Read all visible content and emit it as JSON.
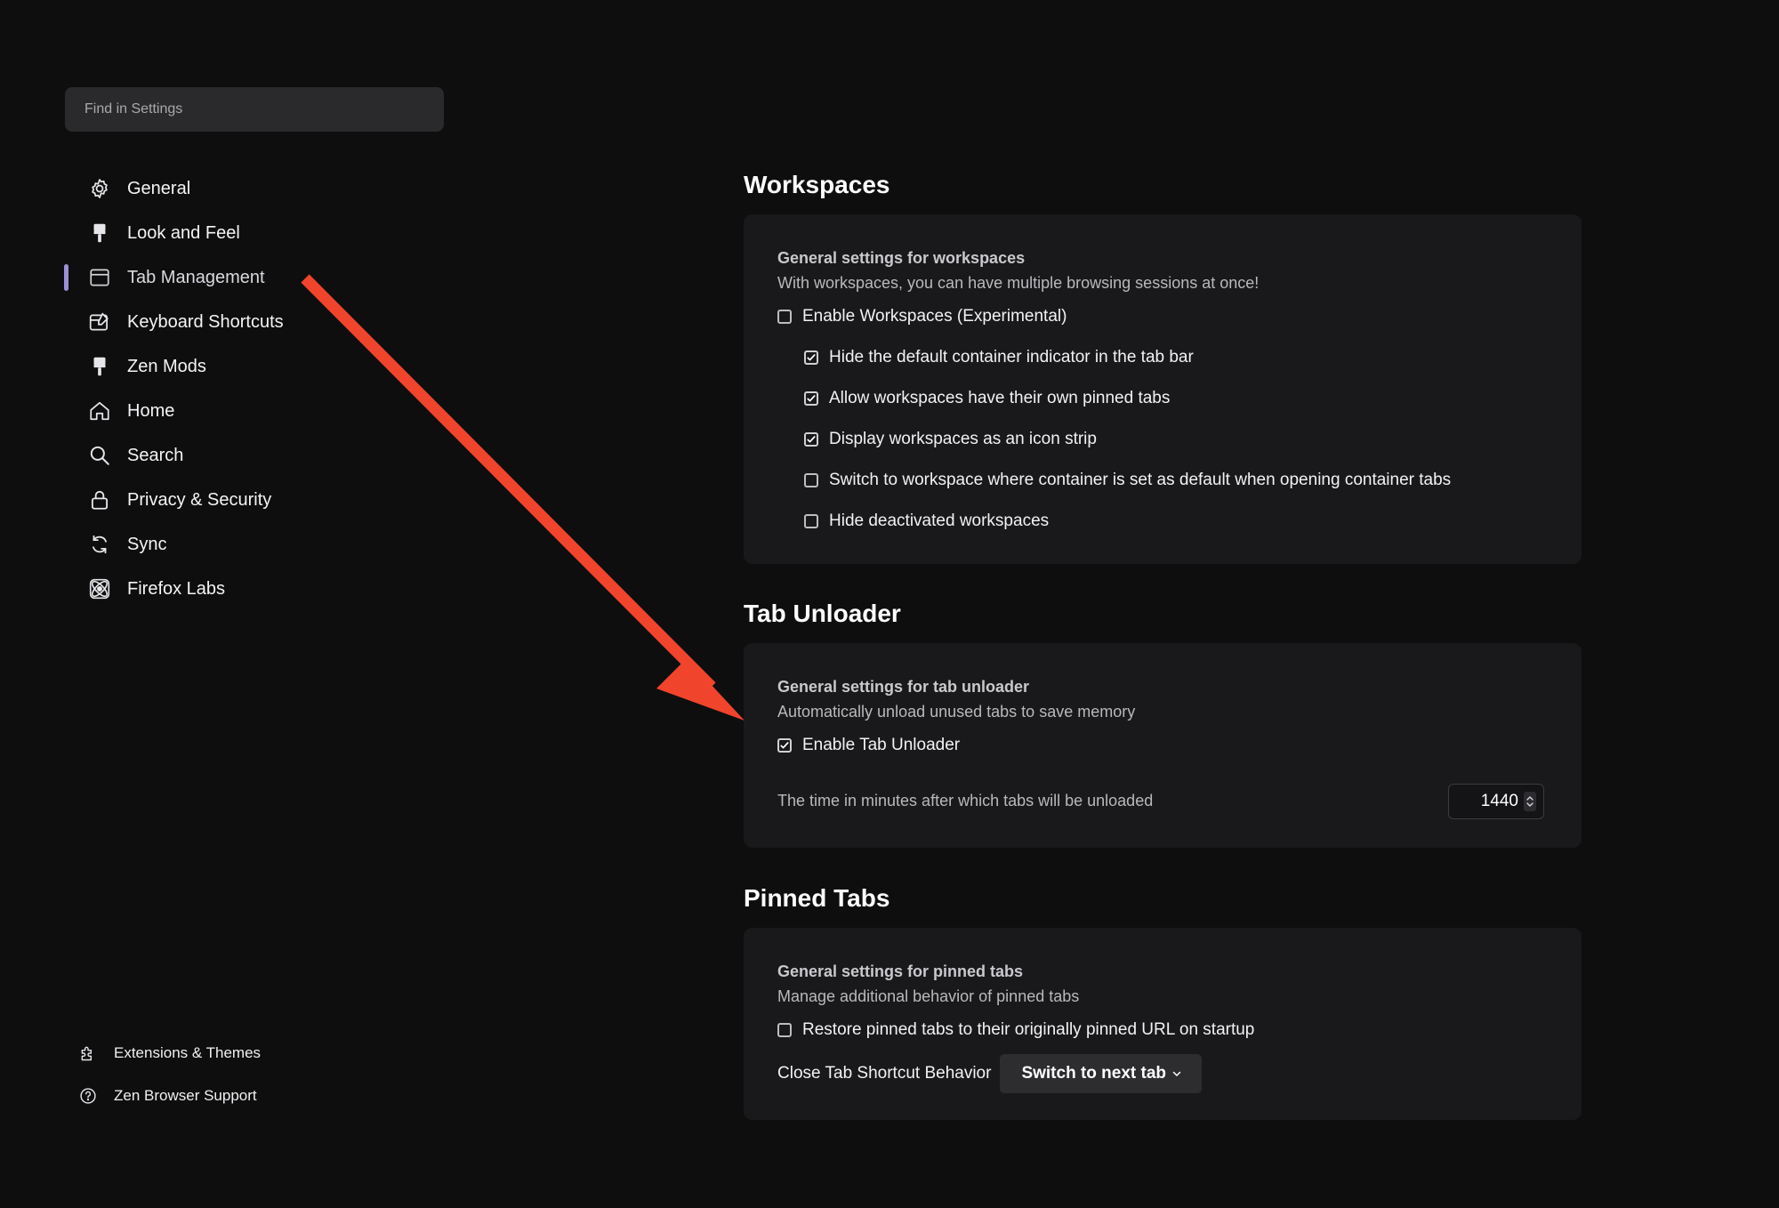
{
  "search": {
    "placeholder": "Find in Settings"
  },
  "sidebar": {
    "items": [
      {
        "label": "General",
        "icon": "gear-icon"
      },
      {
        "label": "Look and Feel",
        "icon": "paintbrush-icon"
      },
      {
        "label": "Tab Management",
        "icon": "window-icon",
        "active": true
      },
      {
        "label": "Keyboard Shortcuts",
        "icon": "keyboard-shortcut-icon"
      },
      {
        "label": "Zen Mods",
        "icon": "paintbrush-icon"
      },
      {
        "label": "Home",
        "icon": "home-icon"
      },
      {
        "label": "Search",
        "icon": "search-icon"
      },
      {
        "label": "Privacy & Security",
        "icon": "lock-icon"
      },
      {
        "label": "Sync",
        "icon": "sync-icon"
      },
      {
        "label": "Firefox Labs",
        "icon": "atom-icon"
      }
    ],
    "footer": [
      {
        "label": "Extensions & Themes",
        "icon": "puzzle-icon"
      },
      {
        "label": "Zen Browser Support",
        "icon": "help-icon"
      }
    ],
    "active_color": "#9d8fd6"
  },
  "workspaces": {
    "title": "Workspaces",
    "heading": "General settings for workspaces",
    "description": "With workspaces, you can have multiple browsing sessions at once!",
    "enable": {
      "label": "Enable Workspaces (Experimental)",
      "checked": false
    },
    "options": [
      {
        "label": "Hide the default container indicator in the tab bar",
        "checked": true
      },
      {
        "label": "Allow workspaces have their own pinned tabs",
        "checked": true
      },
      {
        "label": "Display workspaces as an icon strip",
        "checked": true
      },
      {
        "label": "Switch to workspace where container is set as default when opening container tabs",
        "checked": false
      },
      {
        "label": "Hide deactivated workspaces",
        "checked": false
      }
    ]
  },
  "tab_unloader": {
    "title": "Tab Unloader",
    "heading": "General settings for tab unloader",
    "description": "Automatically unload unused tabs to save memory",
    "enable": {
      "label": "Enable Tab Unloader",
      "checked": true
    },
    "timeout_label": "The time in minutes after which tabs will be unloaded",
    "timeout_value": "1440"
  },
  "pinned_tabs": {
    "title": "Pinned Tabs",
    "heading": "General settings for pinned tabs",
    "description": "Manage additional behavior of pinned tabs",
    "restore": {
      "label": "Restore pinned tabs to their originally pinned URL on startup",
      "checked": false
    },
    "close_behavior_label": "Close Tab Shortcut Behavior",
    "close_behavior_value": "Switch to next tab"
  },
  "annotation": {
    "arrow_color": "#f0442c"
  }
}
